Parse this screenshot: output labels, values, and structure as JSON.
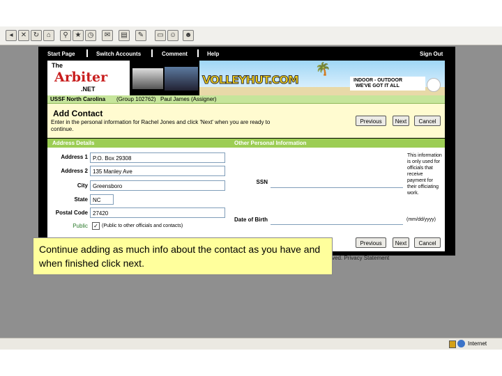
{
  "browser": {
    "toolbar_icons": [
      "back-icon",
      "close-icon",
      "refresh-icon",
      "home-icon",
      "search-icon",
      "favorites-icon",
      "history-icon",
      "mail-icon",
      "print-icon",
      "edit-icon",
      "folder-icon",
      "messenger-icon"
    ],
    "status_text": "Internet"
  },
  "nav": {
    "start_page": "Start Page",
    "switch_accounts": "Switch Accounts",
    "comment": "Comment",
    "help": "Help",
    "sign_out": "Sign Out"
  },
  "banner": {
    "logo_the": "The",
    "logo_arbiter": "Arbiter",
    "logo_net": ".NET",
    "ad_brand": "VOLLEYHUT.COM",
    "ad_tagline_1": "INDOOR - OUTDOOR",
    "ad_tagline_2": "WE'VE GOT IT ALL"
  },
  "account_bar": {
    "group": "USSF North Carolina",
    "group_id": "(Group 102762)",
    "user": "Paul James (Assigner)"
  },
  "page": {
    "title": "Add Contact",
    "instructions": "Enter in the personal information for Rachel Jones and click 'Next' when you are ready to continue.",
    "previous": "Previous",
    "next": "Next",
    "cancel": "Cancel"
  },
  "address": {
    "heading": "Address Details",
    "address1_label": "Address 1",
    "address1": "P.O. Box 29308",
    "address2_label": "Address 2",
    "address2": "135 Manley Ave",
    "city_label": "City",
    "city": "Greensboro",
    "state_label": "State",
    "state": "NC",
    "postal_label": "Postal Code",
    "postal": "27420",
    "public_label": "Public",
    "public_note": "(Public to other officials and contacts)"
  },
  "other": {
    "heading": "Other Personal Information",
    "ssn_label": "SSN",
    "ssn_note": "This information is only used for officials that receive payment for their officiating work.",
    "dob_label": "Date of Birth",
    "dob_format": "(mm/dd/yyyy)"
  },
  "footer": {
    "text": "ved. Privacy Statement"
  },
  "callout": {
    "text": "Continue adding as much info about the contact as you have and when finished click next."
  }
}
